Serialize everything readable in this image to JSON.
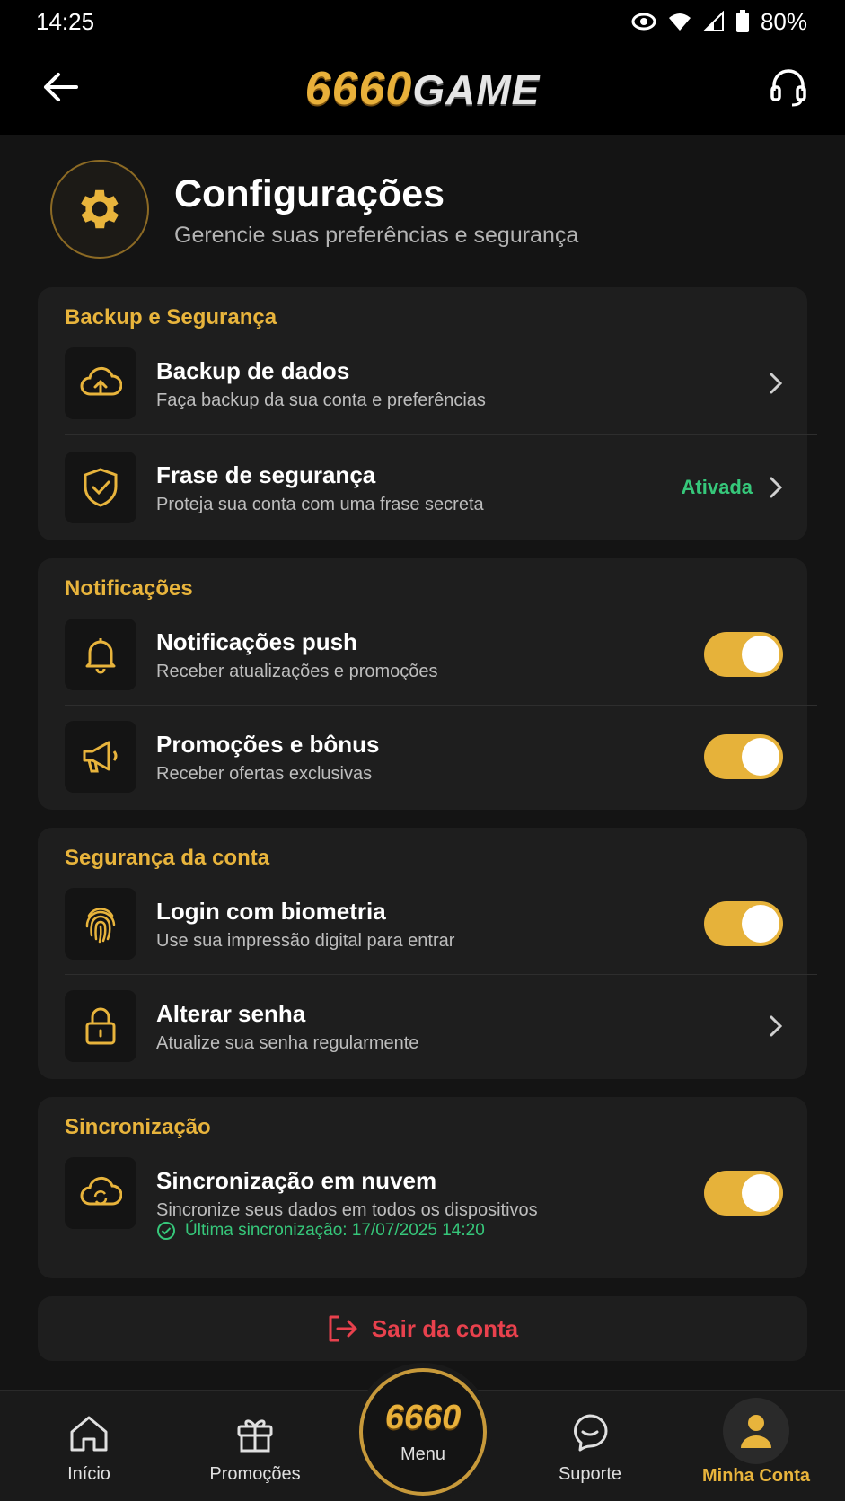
{
  "status_bar": {
    "time": "14:25",
    "battery": "80%"
  },
  "header": {
    "logo_number": "6660",
    "logo_text": "GAME"
  },
  "page": {
    "title": "Configurações",
    "subtitle": "Gerencie suas preferências e segurança"
  },
  "sections": {
    "backup": {
      "title": "Backup e Segurança",
      "items": [
        {
          "title": "Backup de dados",
          "subtitle": "Faça backup da sua conta e preferências",
          "icon": "cloud-upload-icon"
        },
        {
          "title": "Frase de segurança",
          "subtitle": "Proteja sua conta com uma frase secreta",
          "status": "Ativada",
          "icon": "shield-icon"
        }
      ]
    },
    "notifications": {
      "title": "Notificações",
      "items": [
        {
          "title": "Notificações push",
          "subtitle": "Receber atualizações e promoções",
          "enabled": true,
          "icon": "bell-icon"
        },
        {
          "title": "Promoções e bônus",
          "subtitle": "Receber ofertas exclusivas",
          "enabled": true,
          "icon": "megaphone-icon"
        }
      ]
    },
    "account_security": {
      "title": "Segurança da conta",
      "items": [
        {
          "title": "Login com biometria",
          "subtitle": "Use sua impressão digital para entrar",
          "enabled": true,
          "icon": "fingerprint-icon"
        },
        {
          "title": "Alterar senha",
          "subtitle": "Atualize sua senha regularmente",
          "icon": "lock-icon"
        }
      ]
    },
    "sync": {
      "title": "Sincronização",
      "items": [
        {
          "title": "Sincronização em nuvem",
          "subtitle": "Sincronize seus dados em todos os dispositivos",
          "enabled": true,
          "icon": "cloud-sync-icon"
        }
      ],
      "last_sync": "Última sincronização: 17/07/2025 14:20"
    }
  },
  "logout_label": "Sair da conta",
  "bottom_nav": {
    "items": [
      {
        "label": "Início",
        "icon": "home-icon"
      },
      {
        "label": "Promoções",
        "icon": "gift-icon"
      },
      {
        "label": "Menu",
        "logo": "6660"
      },
      {
        "label": "Suporte",
        "icon": "chat-icon"
      },
      {
        "label": "Minha Conta",
        "icon": "user-icon",
        "active": true
      }
    ]
  },
  "colors": {
    "accent": "#e8b43c",
    "success": "#36c77a",
    "danger": "#e8414d",
    "background": "#141414",
    "card": "#1e1e1e"
  }
}
